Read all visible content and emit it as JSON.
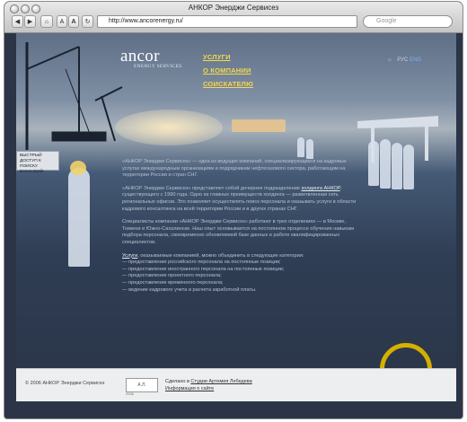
{
  "window": {
    "title": "АНКОР Энерджи Сервисез",
    "toolbar": {
      "text_small": "A",
      "text_large": "A",
      "url": "http://www.ancorenergy.ru/",
      "search_placeholder": "Google"
    }
  },
  "site": {
    "logo": "ancor",
    "logo_sub": "ENERGY SERVICES",
    "nav": [
      {
        "label": "УСЛУГИ"
      },
      {
        "label": "О КОМПАНИИ"
      },
      {
        "label": "СОИСКАТЕЛЮ"
      }
    ],
    "lang": {
      "ru": "РУС",
      "en": "ENG"
    },
    "quick_access": "БЫСТРЫЙ ДОСТУП К ПОИСКУ ВАКАНСИЙ",
    "content": {
      "p1": "«АНКОР Энерджи Сервисез» — одна из ведущих компаний, специализирующихся на кадровых услугах международным организациям и подрядчикам нефтегазового сектора, работающим на территории России и стран СНГ.",
      "p2a": "«АНКОР Энерджи Сервисез» представляет собой дочернее подразделение ",
      "p2link": "холдинга АНКОР",
      "p2b": ", существующего с 1990 года. Одно из главных преимуществ холдинга — разветвленная сеть региональных офисов. Это позволяет осуществлять поиск персонала и оказывать услуги в области кадрового консалтинга на всей территории России и в других странах СНГ.",
      "p3": "Специалисты компании «АНКОР Энерджи Сервисез» работают в трех отделениях — в Москве, Тюмени и Южно-Сахалинске. Наш опыт основывается на постоянном процессе обучения навыкам подбора персонала, своевременно обновляемой базе данных и работе квалифицированных специалистов.",
      "p4link": "Услуги",
      "p4": ", оказываемые компанией, можно объединить в следующие категории:",
      "list": [
        "— предоставление российского персонала на постоянные позиции;",
        "— предоставление иностранного персонала на постоянные позиции;",
        "— предоставление проектного персонала;",
        "— предоставление временного персонала;",
        "— ведение кадрового учета и расчета заработной платы."
      ]
    },
    "footer": {
      "copyright": "© 2006 АНКОР Энерджи Сервисез",
      "made": "Сделано в ",
      "made_link": "Студии Артемия Лебедева",
      "info_link": "Информация о сайте",
      "studio_logo": "А.Л.",
      "year": "2006"
    }
  }
}
